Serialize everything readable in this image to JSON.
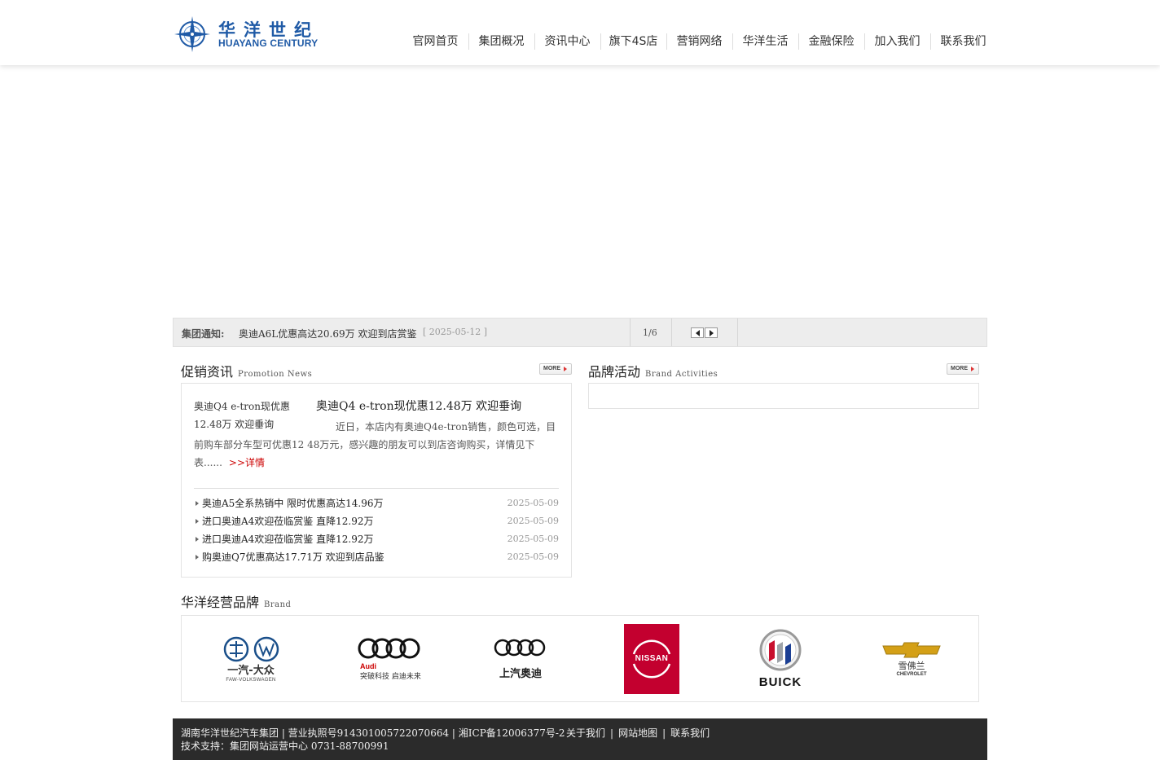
{
  "logo": {
    "cn": "华洋世纪",
    "en": "HUAYANG CENTURY"
  },
  "nav": [
    {
      "label": "官网首页",
      "name": "nav-home"
    },
    {
      "label": "集团概况",
      "name": "nav-group-overview"
    },
    {
      "label": "资讯中心",
      "name": "nav-news-center"
    },
    {
      "label": "旗下4S店",
      "name": "nav-4s-stores"
    },
    {
      "label": "营销网络",
      "name": "nav-sales-network"
    },
    {
      "label": "华洋生活",
      "name": "nav-huayang-life"
    },
    {
      "label": "金融保险",
      "name": "nav-finance-insurance"
    },
    {
      "label": "加入我们",
      "name": "nav-join-us"
    },
    {
      "label": "联系我们",
      "name": "nav-contact-us"
    }
  ],
  "notice": {
    "title": "集团通知:",
    "link": "奥迪A6L优惠高达20.69万 欢迎到店赏鉴",
    "date": "[ 2025-05-12 ]",
    "page": "1/6"
  },
  "promo": {
    "title_cn": "促销资讯",
    "title_en": "Promotion News",
    "more": "MORE",
    "featured": {
      "img_alt": "奥迪Q4 e-tron现优惠12.48万 欢迎垂询",
      "title": "奥迪Q4 e-tron现优惠12.48万 欢迎垂询",
      "desc": "近日，本店内有奥迪Q4e-tron销售，颜色可选，目前购车部分车型可优惠12 48万元，感兴趣的朋友可以到店咨询购买，详情见下表......",
      "more": ">>详情"
    },
    "list": [
      {
        "title": "奥迪A5全系热销中 限时优惠高达14.96万",
        "date": "2025-05-09"
      },
      {
        "title": "进口奥迪A4欢迎莅临赏鉴 直降12.92万",
        "date": "2025-05-09"
      },
      {
        "title": "进口奥迪A4欢迎莅临赏鉴 直降12.92万",
        "date": "2025-05-09"
      },
      {
        "title": "购奥迪Q7优惠高达17.71万 欢迎到店品鉴",
        "date": "2025-05-09"
      }
    ]
  },
  "activities": {
    "title_cn": "品牌活动",
    "title_en": "Brand Activities",
    "more": "MORE"
  },
  "brands": {
    "title_cn": "华洋经营品牌",
    "title_en": "Brand",
    "items": [
      {
        "name": "faw-vw",
        "text": "一汽-大众",
        "sub": "FAW-VOLKSWAGEN"
      },
      {
        "name": "audi",
        "text": "Audi",
        "sub": "突破科技 启迪未来"
      },
      {
        "name": "saic-audi",
        "text": "上汽奥迪"
      },
      {
        "name": "nissan",
        "text": "NISSAN"
      },
      {
        "name": "buick",
        "text": "BUICK"
      },
      {
        "name": "chevrolet",
        "text": "雪佛兰",
        "sub": "CHEVROLET"
      }
    ]
  },
  "footer": {
    "line1": "湖南华洋世纪汽车集团 | 营业执照号914301005722070664 | 湘ICP备12006377号-2",
    "links": [
      "关于我们",
      "网站地图",
      "联系我们"
    ],
    "line2": "技术支持：集团网站运营中心       0731-88700991"
  },
  "colors": {
    "brand_blue": "#1f5aa6",
    "nissan_red": "#c3002f",
    "footer_bg": "#2b2b2b",
    "link_red": "#cc0000"
  }
}
